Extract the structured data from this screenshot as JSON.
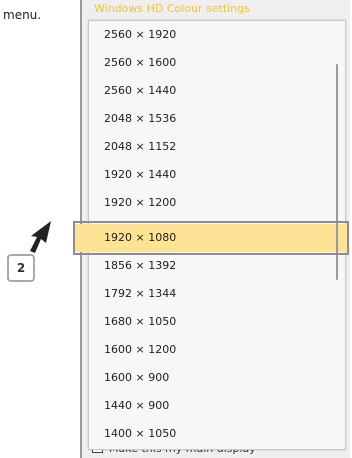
{
  "caption": "menu.",
  "window": {
    "title": "Windows HD Colour settings",
    "footer_text": "Make this my main display"
  },
  "menu": {
    "items": [
      {
        "label": "2560 × 1920",
        "selected": false
      },
      {
        "label": "2560 × 1600",
        "selected": false
      },
      {
        "label": "2560 × 1440",
        "selected": false
      },
      {
        "label": "2048 × 1536",
        "selected": false
      },
      {
        "label": "2048 × 1152",
        "selected": false
      },
      {
        "label": "1920 × 1440",
        "selected": false
      },
      {
        "label": "1920 × 1200",
        "selected": false
      },
      {
        "label": "1920 × 1080",
        "selected": true
      },
      {
        "label": "1856 × 1392",
        "selected": false
      },
      {
        "label": "1792 × 1344",
        "selected": false
      },
      {
        "label": "1680 × 1050",
        "selected": false
      },
      {
        "label": "1600 × 1200",
        "selected": false
      },
      {
        "label": "1600 × 900",
        "selected": false
      },
      {
        "label": "1440 × 900",
        "selected": false
      },
      {
        "label": "1400 × 1050",
        "selected": false
      }
    ]
  },
  "annotation": {
    "step_number": "2"
  },
  "colors": {
    "selected_item": "#ffe394",
    "window_title": "#f2c23a"
  }
}
